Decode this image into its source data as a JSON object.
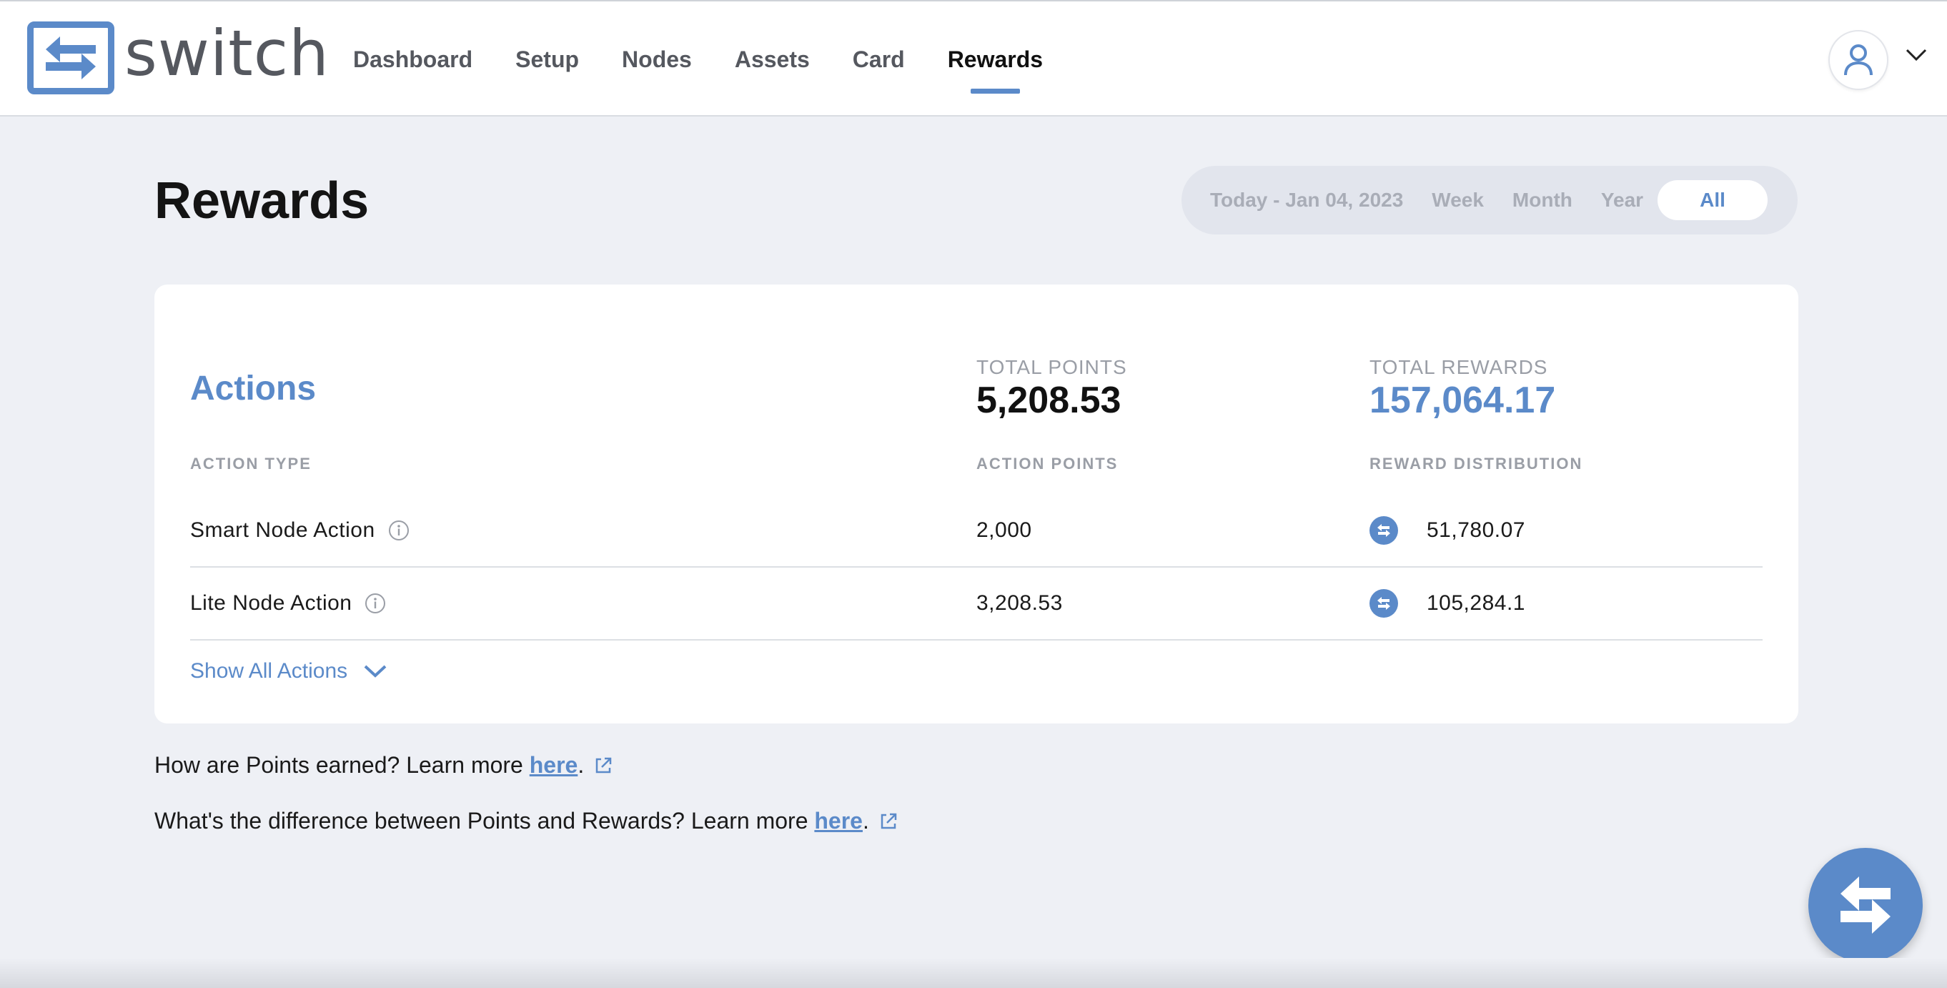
{
  "app": {
    "logo_text": "switch",
    "brand_color": "#5b8ac9"
  },
  "nav": {
    "items": [
      {
        "label": "Dashboard",
        "active": false
      },
      {
        "label": "Setup",
        "active": false
      },
      {
        "label": "Nodes",
        "active": false
      },
      {
        "label": "Assets",
        "active": false
      },
      {
        "label": "Card",
        "active": false
      },
      {
        "label": "Rewards",
        "active": true
      }
    ]
  },
  "user_menu": {
    "avatar_icon": "user-icon",
    "chevron_icon": "chevron-down-icon"
  },
  "page": {
    "title": "Rewards"
  },
  "range_filter": {
    "options": [
      {
        "label": "Today - Jan 04, 2023",
        "active": false
      },
      {
        "label": "Week",
        "active": false
      },
      {
        "label": "Month",
        "active": false
      },
      {
        "label": "Year",
        "active": false
      },
      {
        "label": "All",
        "active": true
      }
    ]
  },
  "actions_card": {
    "title": "Actions",
    "total_points_label": "TOTAL POINTS",
    "total_points_value": "5,208.53",
    "total_rewards_label": "TOTAL REWARDS",
    "total_rewards_value": "157,064.17",
    "columns": {
      "type": "ACTION TYPE",
      "points": "ACTION POINTS",
      "distribution": "REWARD DISTRIBUTION"
    },
    "rows": [
      {
        "type": "Smart Node Action",
        "points": "2,000",
        "reward": "51,780.07"
      },
      {
        "type": "Lite Node Action",
        "points": "3,208.53",
        "reward": "105,284.1"
      }
    ],
    "show_all_label": "Show All Actions"
  },
  "help": {
    "line1_prefix": "How are Points earned? Learn more ",
    "line1_link": "here",
    "line1_suffix": ".",
    "line2_prefix": "What's the difference between Points and Rewards? Learn more ",
    "line2_link": "here",
    "line2_suffix": "."
  }
}
